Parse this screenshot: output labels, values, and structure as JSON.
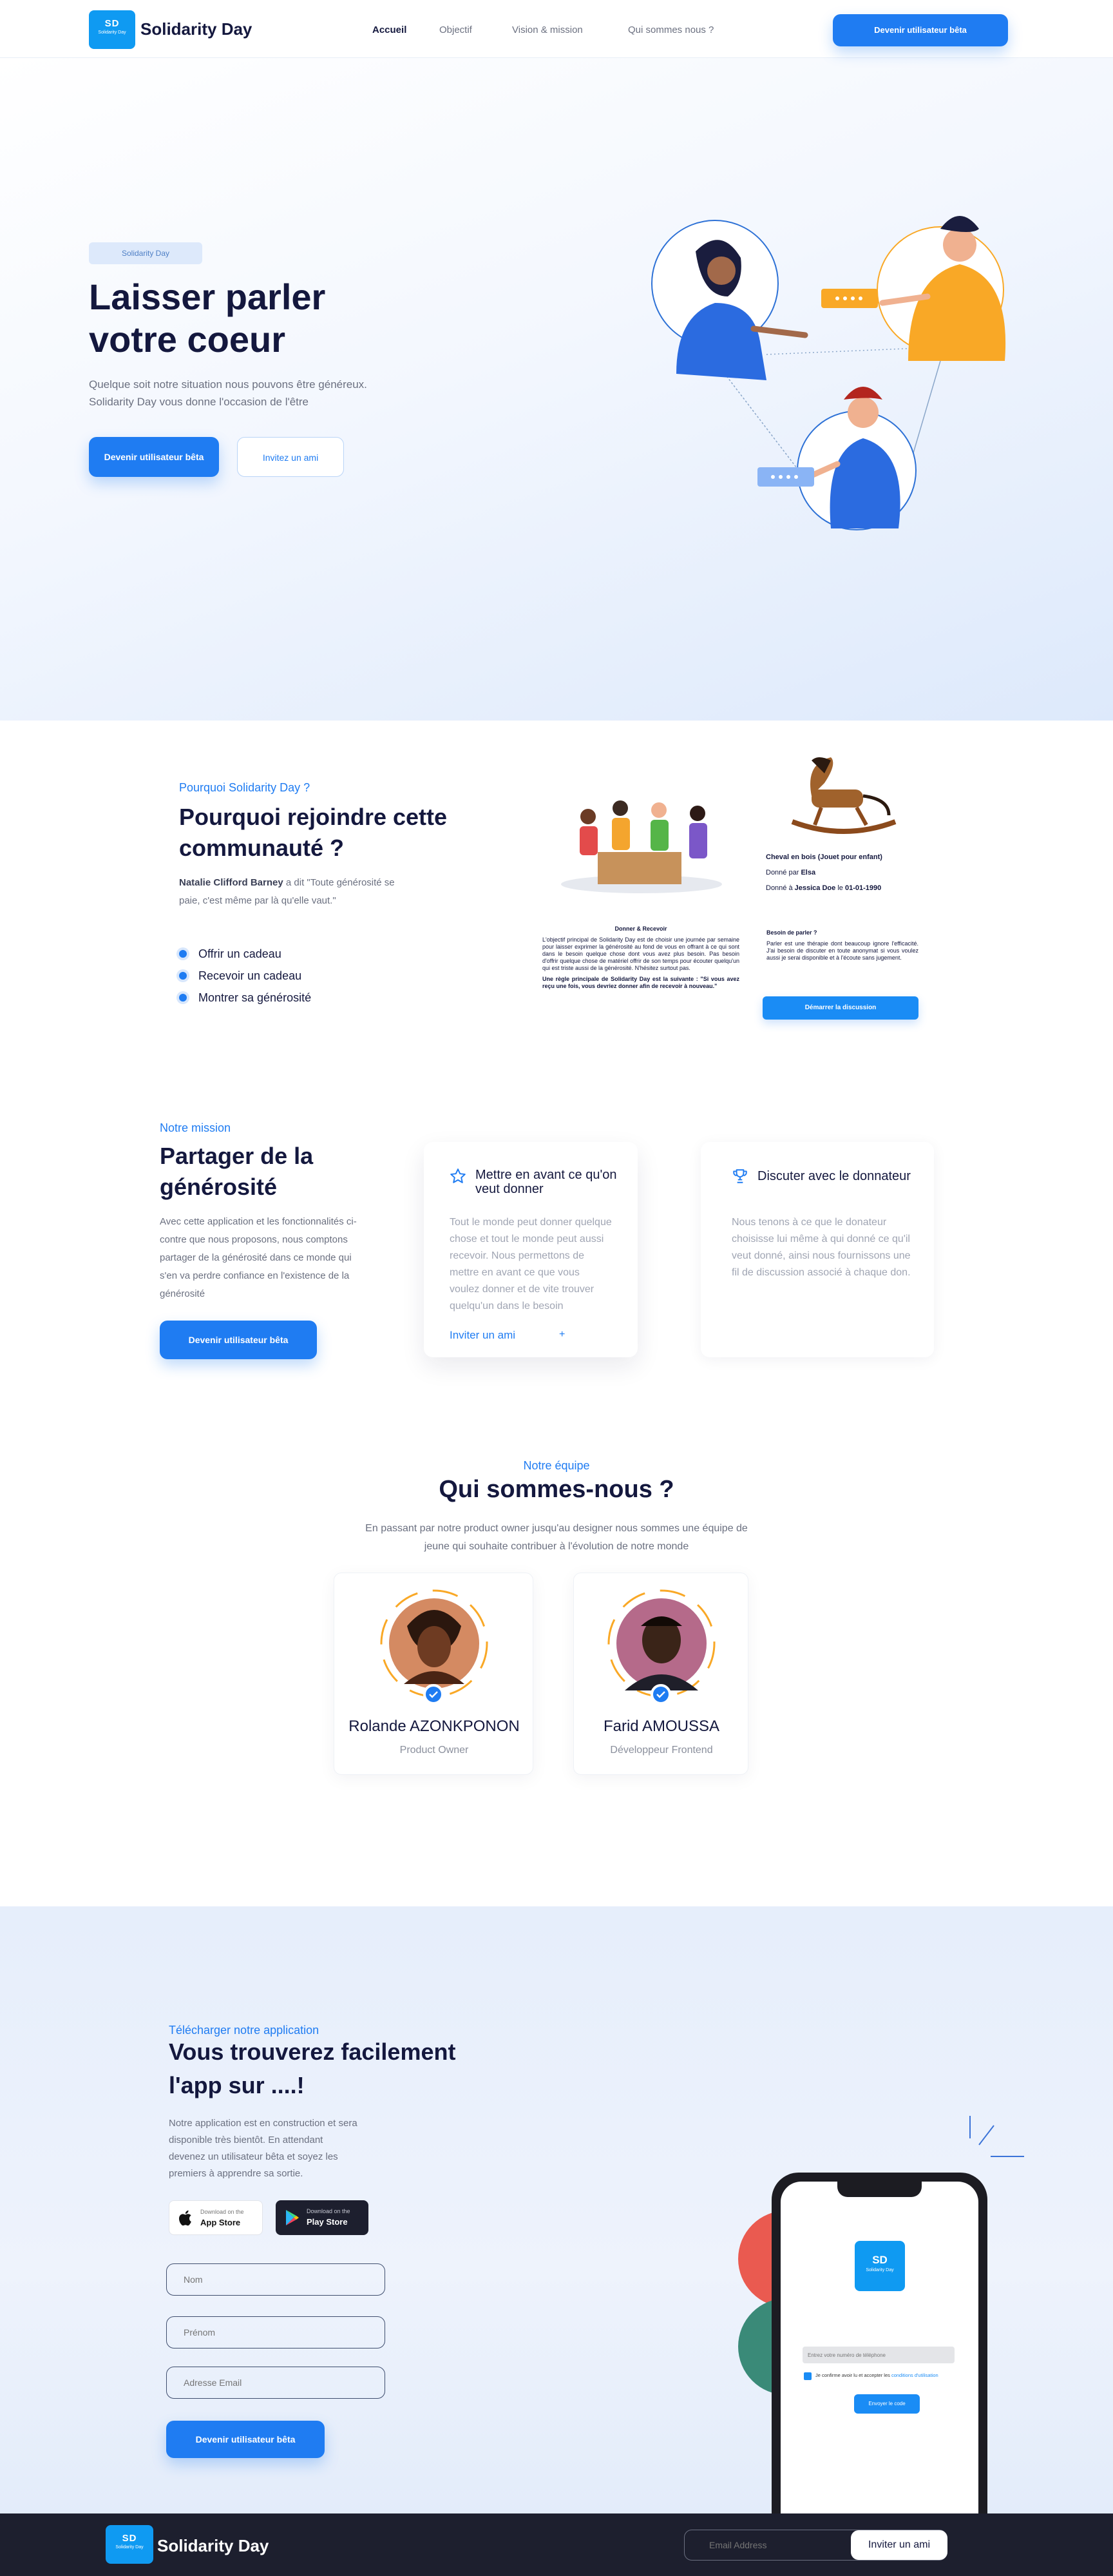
{
  "header": {
    "logo": {
      "mark": "SD",
      "sub": "Solidarity Day",
      "name": "Solidarity Day"
    },
    "nav": [
      "Accueil",
      "Objectif",
      "Vision & mission",
      "Qui sommes nous ?"
    ],
    "cta": "Devenir utilisateur bêta"
  },
  "hero": {
    "tag": "Solidarity Day",
    "title_line1": "Laisser parler",
    "title_line2": "votre coeur",
    "desc_line1": "Quelque soit notre situation nous pouvons être généreux.",
    "desc_line2": "Solidarity Day vous donne l'occasion de l'être",
    "primary_btn": "Devenir utilisateur bêta",
    "secondary_btn": "Invitez un ami"
  },
  "why": {
    "tag": "Pourquoi Solidarity Day ?",
    "title_line1": "Pourquoi rejoindre cette",
    "title_line2": "communauté ?",
    "quote_author": "Natalie Clifford Barney",
    "quote_said": " a dit \"Toute générosité se",
    "quote_line2": "paie, c'est même par là qu'elle vaut.\"",
    "bullets": [
      "Offrir un cadeau",
      "Recevoir un cadeau",
      "Montrer sa générosité"
    ],
    "mock": {
      "gift_title": "Cheval en bois (Jouet pour enfant)",
      "given_by_label": "Donné par ",
      "given_by": "Elsa",
      "given_to_label": "Donné à ",
      "given_to": "Jessica Doe",
      "given_on_label": " le ",
      "given_on": "01-01-1990",
      "give_receive_title": "Donner & Recevoir",
      "give_receive_text": "L'objectif principal de Solidarity Day est de choisir une journée par semaine pour laisser exprimer la générosité au fond de vous en offrant à ce qui sont dans le besoin quelque chose dont vous avez plus besoin. Pas besoin d'offrir quelque chose de matériel offrir de son temps pour écouter quelqu'un qui est triste aussi de la générosité. N'hésitez surtout pas.",
      "rule_text": "Une règle principale de Solidarity Day est la suivante : \"Si vous avez reçu une fois, vous devriez donner afin de recevoir à nouveau.\"",
      "need_title": "Besoin de parler ?",
      "need_text": "Parler est une thérapie dont beaucoup ignore l'efficacité. J'ai besoin de discuter en toute anonymat si vous voulez aussi je serai disponible et à l'écoute sans jugement.",
      "start_btn": "Démarrer la discussion"
    }
  },
  "mission": {
    "tag": "Notre mission",
    "title_line1": "Partager de la",
    "title_line2": "générosité",
    "desc": [
      "Avec cette application et les fonctionnalités ci-",
      "contre que nous proposons, nous comptons",
      "partager de la générosité dans ce monde qui",
      "s'en va perdre confiance en l'existence de la",
      "générosité"
    ],
    "btn": "Devenir utilisateur bêta",
    "card1": {
      "title_line1": "Mettre en avant ce qu'on",
      "title_line2": "veut donner",
      "text": [
        "Tout le monde peut donner quelque",
        "chose et tout le monde peut aussi",
        "recevoir. Nous permettons de",
        "mettre en avant ce que vous",
        "voulez donner et de vite trouver",
        "quelqu'un dans le besoin"
      ],
      "link": "Inviter un ami",
      "link_arrow": "+"
    },
    "card2": {
      "title": "Discuter avec le donnateur",
      "text": [
        "Nous tenons à ce que le donateur",
        "choisisse lui même à qui donné ce qu'il",
        "veut donné, ainsi nous fournissons une",
        "fil de discussion associé à chaque don."
      ]
    }
  },
  "team": {
    "tag": "Notre équipe",
    "title": "Qui sommes-nous ?",
    "desc_line1": "En passant par notre product owner jusqu'au designer nous sommes une équipe de",
    "desc_line2": "jeune qui souhaite contribuer à l'évolution de notre monde",
    "members": [
      {
        "name": "Rolande AZONKPONON",
        "role": "Product Owner"
      },
      {
        "name": "Farid AMOUSSA",
        "role": "Développeur Frontend"
      }
    ]
  },
  "download": {
    "tag": "Télécharger notre application",
    "title_line1": "Vous trouverez facilement",
    "title_line2": "l'app sur ....!",
    "desc": [
      "Notre application est en construction et sera",
      "disponible très bientôt. En attendant",
      "devenez un utilisateur bêta et soyez les",
      "premiers à apprendre sa sortie."
    ],
    "appstore_small": "Download on the",
    "appstore_big": "App Store",
    "playstore_small": "Download on the",
    "playstore_big": "Play Store",
    "fields": {
      "nom": "Nom",
      "prenom": "Prénom",
      "email": "Adresse Email"
    },
    "btn": "Devenir utilisateur bêta",
    "phone": {
      "logo_mark": "SD",
      "logo_sub": "Solidarity Day",
      "phone_placeholder": "Entrez votre numéro de téléphone",
      "consent_text": "Je confirme avoir lu et accepter les ",
      "consent_link": "conditions d'utilisation",
      "phone_btn": "Envoyer le code"
    }
  },
  "footer": {
    "logo_mark": "SD",
    "logo_sub": "Solidarity Day",
    "name": "Solidarity Day",
    "email_placeholder": "Email Address",
    "invite_btn": "Inviter un ami"
  },
  "colors": {
    "primary": "#1f7cf2",
    "dark": "#14183e",
    "footer": "#1d1f2e",
    "accent_orange": "#f9a826"
  }
}
